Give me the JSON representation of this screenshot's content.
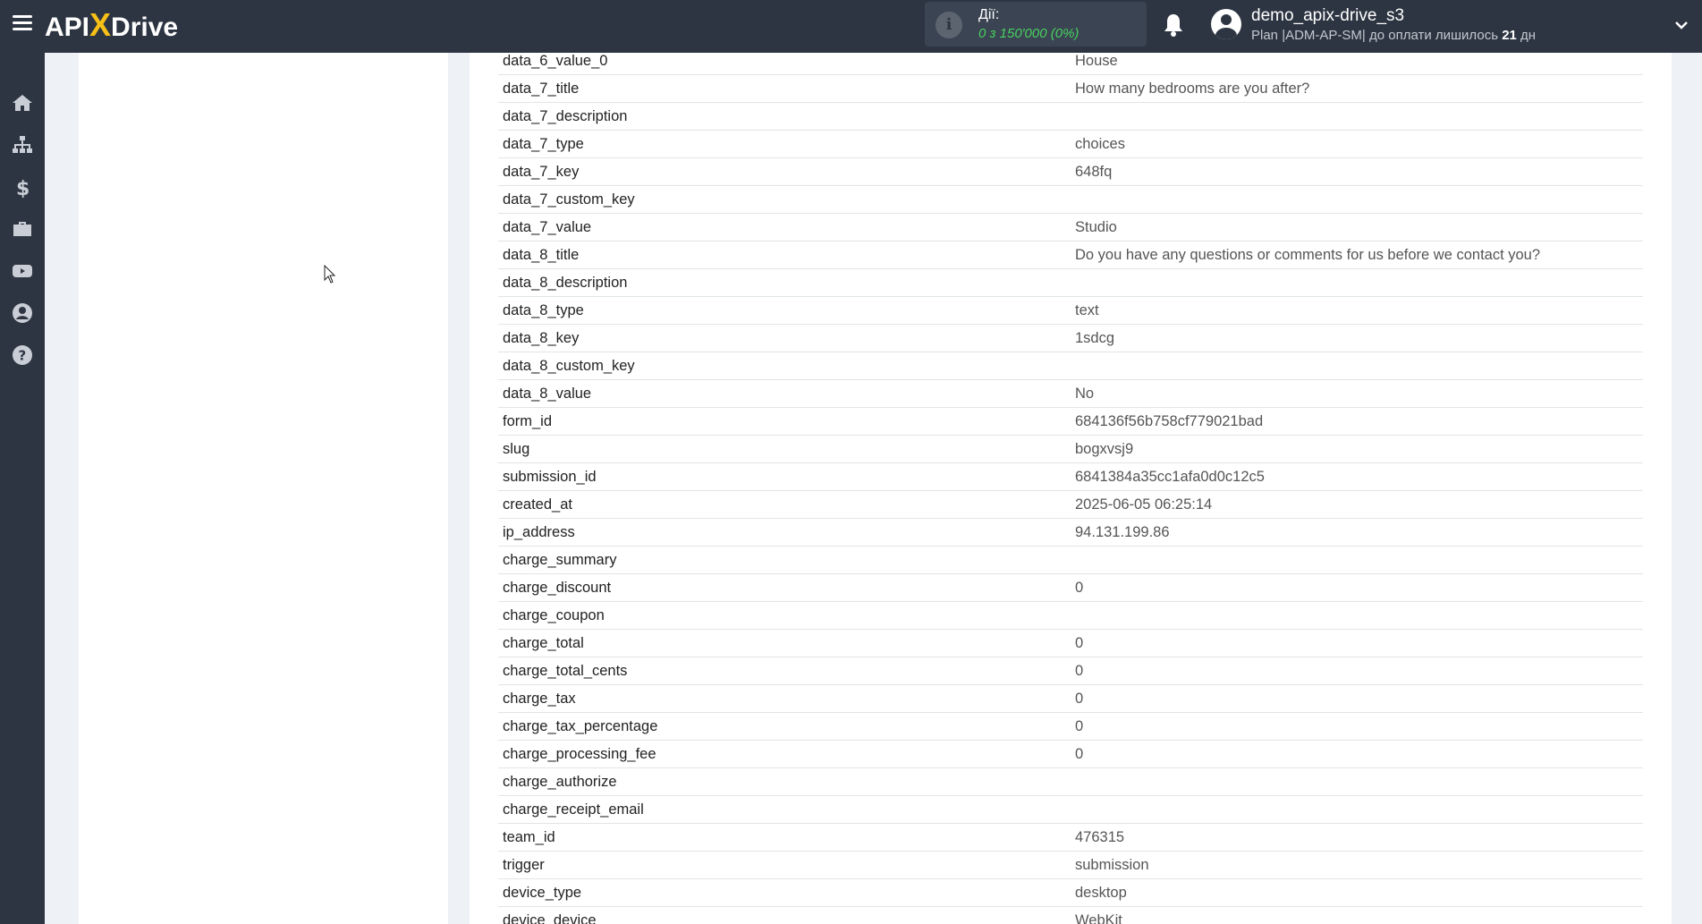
{
  "app": {
    "logo_api": "API",
    "logo_x": "X",
    "logo_drive": "Drive"
  },
  "header": {
    "actions_label": "Дії:",
    "actions_count": "0 з 150'000 (0%)",
    "username": "demo_apix-drive_s3",
    "plan_prefix": "Plan |ADM-AP-SM| до оплати лишилось ",
    "plan_days": "21",
    "plan_suffix": " дн"
  },
  "sidebar": {
    "items": [
      {
        "name": "home-icon"
      },
      {
        "name": "sitemap-icon"
      },
      {
        "name": "dollar-icon"
      },
      {
        "name": "briefcase-icon"
      },
      {
        "name": "youtube-icon"
      },
      {
        "name": "user-icon"
      },
      {
        "name": "help-icon"
      }
    ]
  },
  "table": {
    "rows": [
      {
        "key": "data_6_value_0",
        "value": "House"
      },
      {
        "key": "data_7_title",
        "value": "How many bedrooms are you after?"
      },
      {
        "key": "data_7_description",
        "value": ""
      },
      {
        "key": "data_7_type",
        "value": "choices"
      },
      {
        "key": "data_7_key",
        "value": "648fq"
      },
      {
        "key": "data_7_custom_key",
        "value": ""
      },
      {
        "key": "data_7_value",
        "value": "Studio"
      },
      {
        "key": "data_8_title",
        "value": "Do you have any questions or comments for us before we contact you?"
      },
      {
        "key": "data_8_description",
        "value": ""
      },
      {
        "key": "data_8_type",
        "value": "text"
      },
      {
        "key": "data_8_key",
        "value": "1sdcg"
      },
      {
        "key": "data_8_custom_key",
        "value": ""
      },
      {
        "key": "data_8_value",
        "value": "No"
      },
      {
        "key": "form_id",
        "value": "684136f56b758cf779021bad"
      },
      {
        "key": "slug",
        "value": "bogxvsj9"
      },
      {
        "key": "submission_id",
        "value": "6841384a35cc1afa0d0c12c5"
      },
      {
        "key": "created_at",
        "value": "2025-06-05 06:25:14"
      },
      {
        "key": "ip_address",
        "value": "94.131.199.86"
      },
      {
        "key": "charge_summary",
        "value": ""
      },
      {
        "key": "charge_discount",
        "value": "0"
      },
      {
        "key": "charge_coupon",
        "value": ""
      },
      {
        "key": "charge_total",
        "value": "0"
      },
      {
        "key": "charge_total_cents",
        "value": "0"
      },
      {
        "key": "charge_tax",
        "value": "0"
      },
      {
        "key": "charge_tax_percentage",
        "value": "0"
      },
      {
        "key": "charge_processing_fee",
        "value": "0"
      },
      {
        "key": "charge_authorize",
        "value": ""
      },
      {
        "key": "charge_receipt_email",
        "value": ""
      },
      {
        "key": "team_id",
        "value": "476315"
      },
      {
        "key": "trigger",
        "value": "submission"
      },
      {
        "key": "device_type",
        "value": "desktop"
      },
      {
        "key": "device_device",
        "value": "WebKit"
      }
    ]
  }
}
